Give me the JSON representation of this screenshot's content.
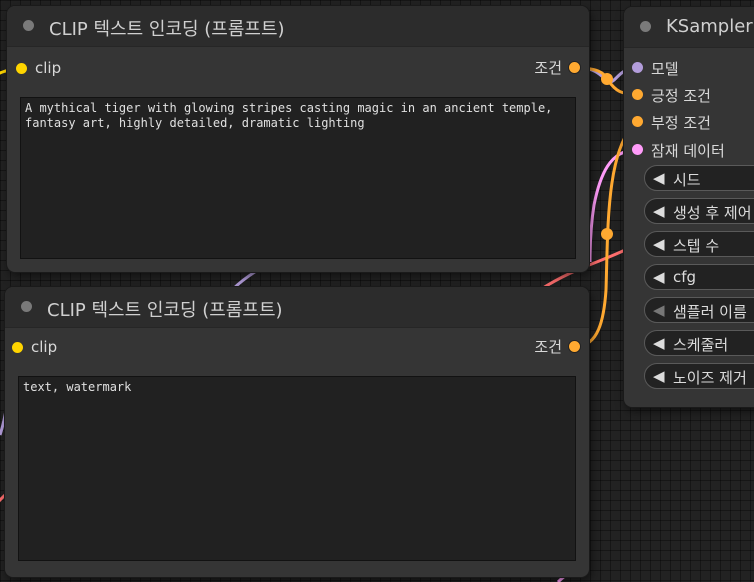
{
  "colors": {
    "clip": "#ffd500",
    "conditioning": "#ffa931",
    "model": "#b39ddb",
    "latent": "#ff9cf9",
    "vae_link": "#ff6e6e"
  },
  "icons": {
    "node_collapse": "circle-icon",
    "widget_arrow": "left-triangle-icon"
  },
  "node_positive": {
    "title": "CLIP 텍스트 인코딩 (프롬프트)",
    "input_label": "clip",
    "output_label": "조건",
    "text": "A mythical tiger with glowing stripes casting magic in an ancient temple,\nfantasy art, highly detailed, dramatic lighting"
  },
  "node_negative": {
    "title": "CLIP 텍스트 인코딩 (프롬프트)",
    "input_label": "clip",
    "output_label": "조건",
    "text": "text, watermark"
  },
  "ksampler": {
    "title": "KSampler",
    "inputs": [
      "모델",
      "긍정 조건",
      "부정 조건",
      "잠재 데이터"
    ],
    "widget_arrow": "◀",
    "widgets": [
      "시드",
      "생성 후 제어",
      "스텝 수",
      "cfg",
      "샘플러 이름",
      "스케줄러",
      "노이즈 제거"
    ]
  }
}
